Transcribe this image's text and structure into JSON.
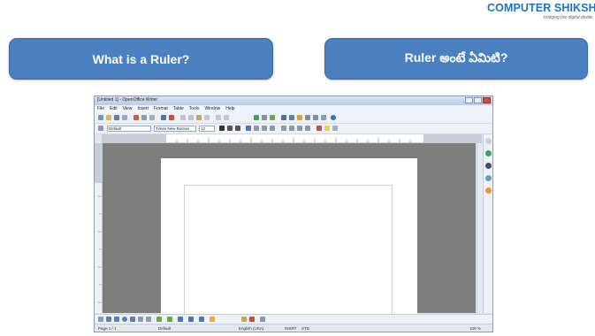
{
  "logo": {
    "name": "COMPUTER SHIKSHA",
    "tagline": "bridging the digital divide"
  },
  "left_panel": {
    "title": "What is a Ruler?"
  },
  "right_panel": {
    "title": "Ruler అంటే ఏమిటి?"
  },
  "app": {
    "window_title": "[Untitled 1] - OpenOffice Writer",
    "menus": [
      "File",
      "Edit",
      "View",
      "Insert",
      "Format",
      "Table",
      "Tools",
      "Window",
      "Help"
    ],
    "paragraph_style": "Default",
    "font_name": "Times New Roman",
    "font_size": "12",
    "status": {
      "page": "Page 1 / 1",
      "style": "Default",
      "language": "English (USA)",
      "mode": "INSRT",
      "selection": "STD",
      "zoom": "100 %"
    }
  },
  "colors": {
    "panel_bg": "#4a7fc0",
    "logo_blue": "#1e73be",
    "workspace": "#7e7e7e"
  }
}
